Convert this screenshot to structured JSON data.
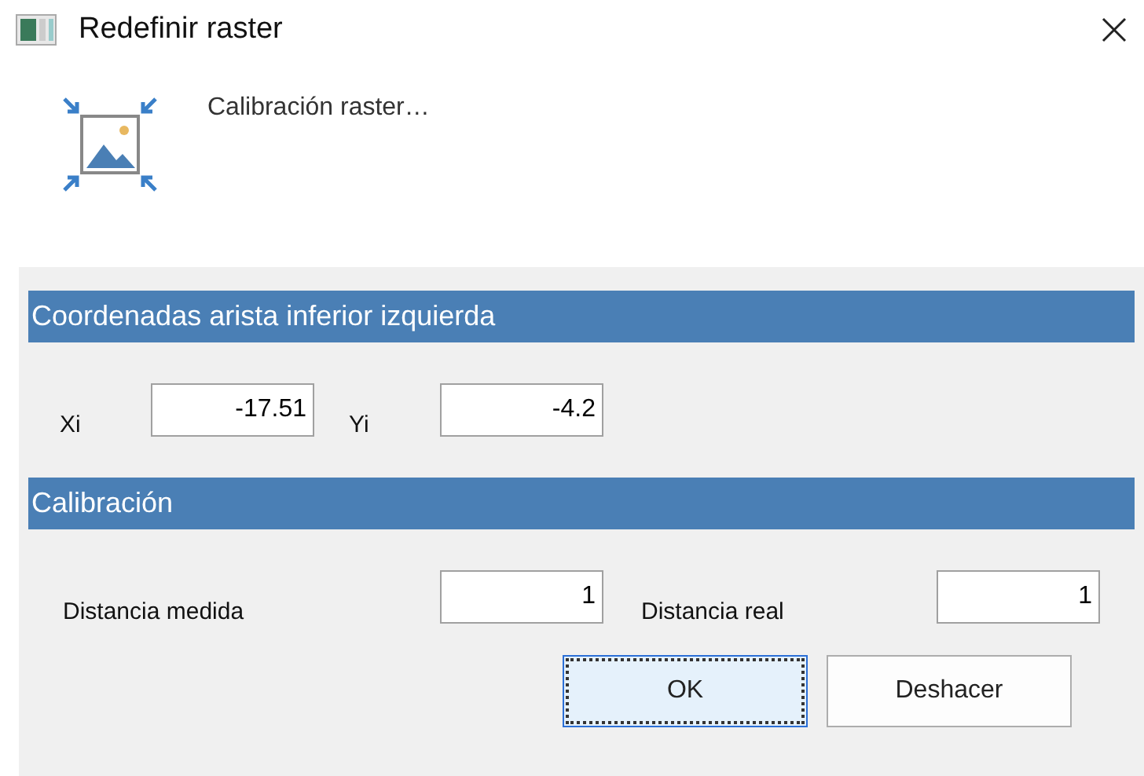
{
  "window": {
    "title": "Redefinir raster"
  },
  "header": {
    "text": "Calibración raster…"
  },
  "sections": [
    {
      "title": "Coordenadas arista inferior izquierda",
      "kind": "coords",
      "fields": [
        {
          "label": "Xi",
          "value": "-17.51"
        },
        {
          "label": "Yi",
          "value": "-4.2"
        }
      ]
    },
    {
      "title": "Calibración",
      "kind": "calibration",
      "fields": [
        {
          "label": "Distancia medida",
          "value": "1"
        },
        {
          "label": "Distancia real",
          "value": "1"
        }
      ]
    }
  ],
  "buttons": [
    {
      "label": "OK",
      "focused": true
    },
    {
      "label": "Deshacer",
      "focused": false
    }
  ]
}
